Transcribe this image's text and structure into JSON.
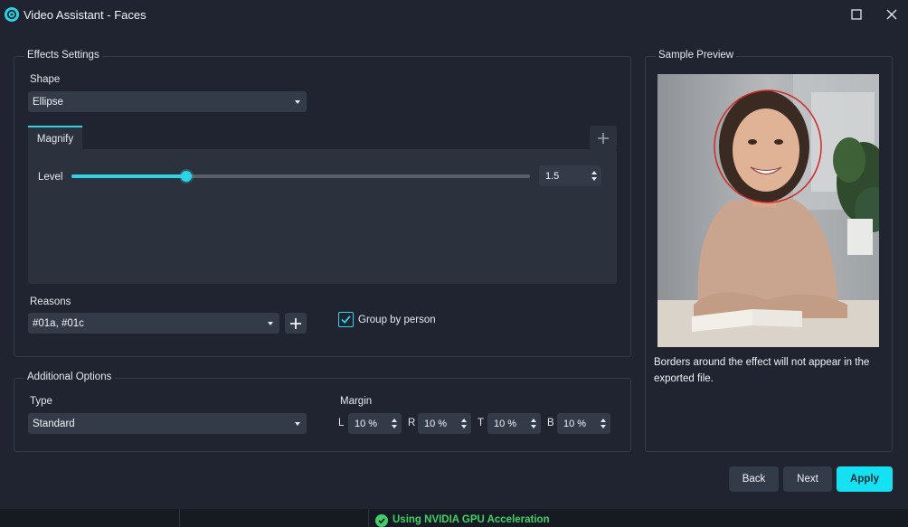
{
  "window": {
    "title": "Video Assistant - Faces",
    "icon": "app-logo-icon",
    "buttons": [
      "maximize-icon",
      "close-icon"
    ]
  },
  "effects_settings": {
    "group_title": "Effects Settings",
    "shape_label": "Shape",
    "shape_value": "Ellipse",
    "tabs": [
      {
        "label": "Magnify",
        "active": true
      }
    ],
    "add_tab_icon": "plus-icon",
    "level_label": "Level",
    "level_value": "1.5",
    "level_slider_fraction": 0.25,
    "reasons_label": "Reasons",
    "reasons_value": "#01a, #01c",
    "add_reason_icon": "plus-icon",
    "group_by_person_label": "Group by person",
    "group_by_person_checked": true
  },
  "additional_options": {
    "group_title": "Additional Options",
    "type_label": "Type",
    "type_value": "Standard",
    "margin_label": "Margin",
    "margins": [
      {
        "side": "L",
        "value": "10 %"
      },
      {
        "side": "R",
        "value": "10 %"
      },
      {
        "side": "T",
        "value": "10 %"
      },
      {
        "side": "B",
        "value": "10 %"
      }
    ]
  },
  "sample_preview": {
    "group_title": "Sample Preview",
    "note": "Borders around the effect will not appear in the exported file."
  },
  "footer": {
    "back_label": "Back",
    "next_label": "Next",
    "apply_label": "Apply"
  },
  "status": {
    "text": "Using NVIDIA GPU Acceleration",
    "icon": "check-circle-icon"
  },
  "colors": {
    "accent": "#2fd3e6",
    "primary_button": "#14e2f2",
    "status_ok": "#3fd06a",
    "background": "#1f2430"
  }
}
